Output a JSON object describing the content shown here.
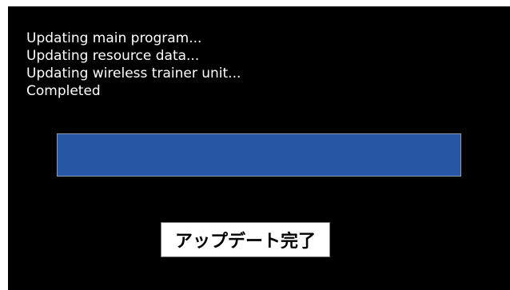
{
  "log_lines": [
    "Updating main program...",
    "Updating resource data...",
    "Updating wireless trainer unit...",
    "Completed"
  ],
  "progress": {
    "percent": 100,
    "fill_color": "#2656a4"
  },
  "status_box": {
    "text": "アップデート完了"
  }
}
